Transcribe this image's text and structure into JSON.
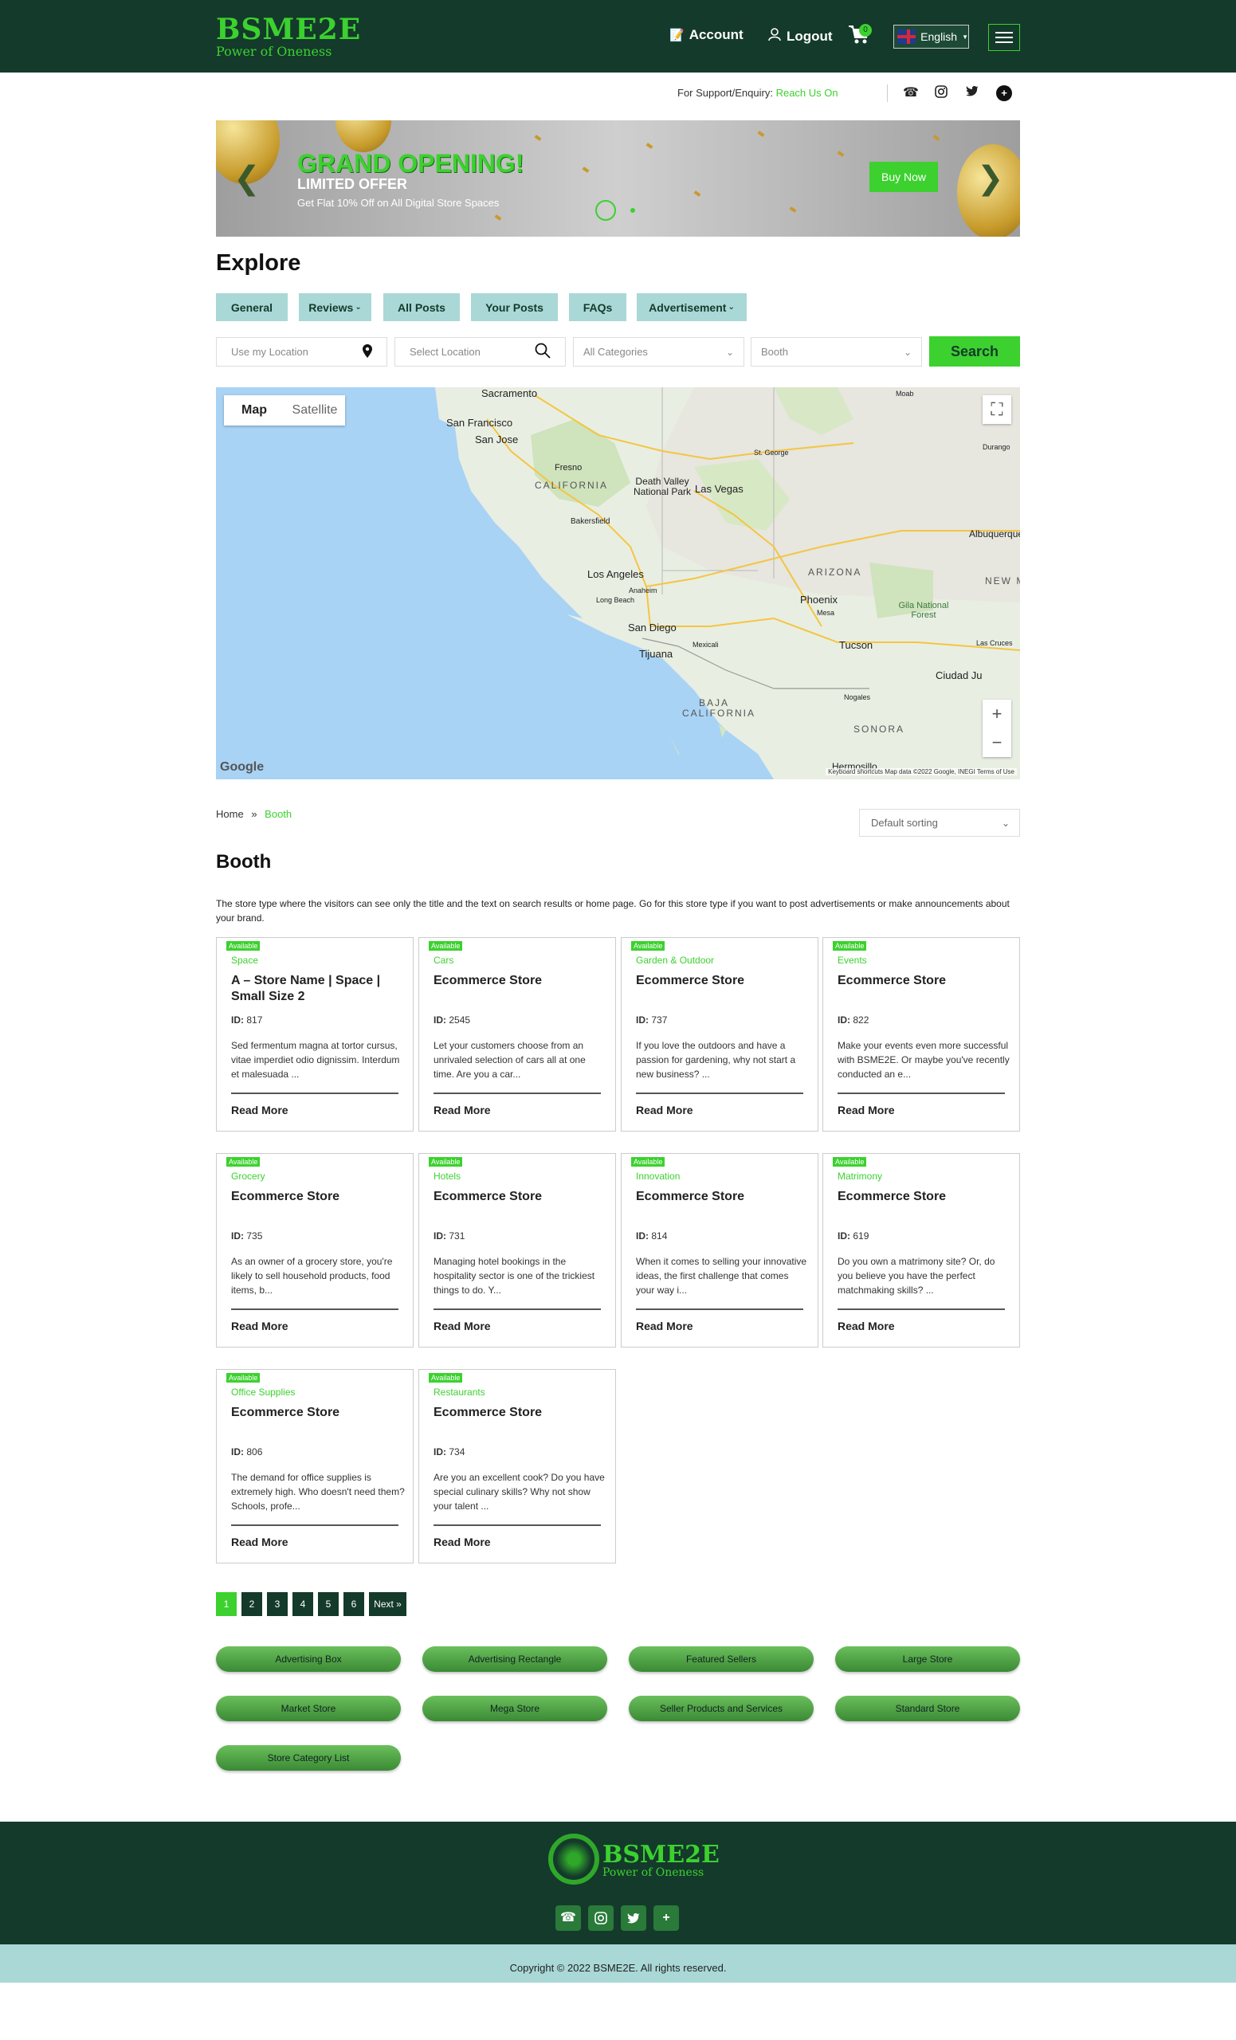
{
  "header": {
    "logo_main": "BSME2E",
    "logo_sub": "Power of Oneness",
    "account": "Account",
    "logout": "Logout",
    "cart_count": "0",
    "language": "English"
  },
  "support": {
    "label": "For Support/Enquiry:",
    "link": "Reach Us On"
  },
  "banner": {
    "title": "GRAND OPENING!",
    "subtitle": "LIMITED OFFER",
    "text": "Get Flat 10% Off on All Digital Store Spaces",
    "button": "Buy Now"
  },
  "explore": {
    "title": "Explore",
    "tabs": [
      "General",
      "Reviews",
      "All Posts",
      "Your Posts",
      "FAQs",
      "Advertisement"
    ]
  },
  "search": {
    "location_placeholder": "Use my Location",
    "select_location": "Select Location",
    "categories": "All Categories",
    "type": "Booth",
    "button": "Search"
  },
  "map": {
    "map_btn": "Map",
    "satellite_btn": "Satellite",
    "cities": [
      "Sacramento",
      "San Francisco",
      "San Jose",
      "Fresno",
      "CALIFORNIA",
      "Death Valley National Park",
      "Las Vegas",
      "Bakersfield",
      "Los Angeles",
      "Anaheim",
      "Long Beach",
      "San Diego",
      "Tijuana",
      "Mexicali",
      "Phoenix",
      "Mesa",
      "Tucson",
      "ARIZONA",
      "Albuquerque",
      "Gila National Forest",
      "Ciudad Ju",
      "Nogales",
      "SONORA",
      "BAJA CALIFORNIA",
      "Hermosillo",
      "St. George",
      "Moab",
      "Durango",
      "Las Cruces",
      "NEW M"
    ],
    "footer": "Keyboard shortcuts Map data ©2022 Google, INEGI Terms of Use"
  },
  "breadcrumb": {
    "home": "Home",
    "sep": "»",
    "current": "Booth"
  },
  "sorting": "Default sorting",
  "booth": {
    "title": "Booth",
    "description": "The store type where the visitors can see only the title and the text on search results or home page. Go for this store type if you want to post advertisements or make announcements about your brand."
  },
  "cards": [
    {
      "badge": "Available",
      "category": "Space",
      "title": "A – Store Name | Space | Small Size 2",
      "id_label": "ID:",
      "id": "817",
      "desc": "Sed fermentum magna at tortor cursus, vitae imperdiet odio dignissim. Interdum et malesuada ...",
      "read": "Read More"
    },
    {
      "badge": "Available",
      "category": "Cars",
      "title": "Ecommerce Store",
      "id_label": "ID:",
      "id": "2545",
      "desc": "Let your customers choose from an unrivaled selection of cars all at one time. Are you a car...",
      "read": "Read More"
    },
    {
      "badge": "Available",
      "category": "Garden & Outdoor",
      "title": "Ecommerce Store",
      "id_label": "ID:",
      "id": "737",
      "desc": "If you love the outdoors and have a passion for gardening, why not start a new business? ...",
      "read": "Read More"
    },
    {
      "badge": "Available",
      "category": "Events",
      "title": "Ecommerce Store",
      "id_label": "ID:",
      "id": "822",
      "desc": "Make your events even more successful with BSME2E. Or maybe you've recently conducted an e...",
      "read": "Read More"
    },
    {
      "badge": "Available",
      "category": "Grocery",
      "title": "Ecommerce Store",
      "id_label": "ID:",
      "id": "735",
      "desc": "As an owner of a grocery store, you're likely to sell household products, food items, b...",
      "read": "Read More"
    },
    {
      "badge": "Available",
      "category": "Hotels",
      "title": "Ecommerce Store",
      "id_label": "ID:",
      "id": "731",
      "desc": "Managing hotel bookings in the hospitality sector is one of the trickiest things to do. Y...",
      "read": "Read More"
    },
    {
      "badge": "Available",
      "category": "Innovation",
      "title": "Ecommerce Store",
      "id_label": "ID:",
      "id": "814",
      "desc": "When it comes to selling your innovative ideas, the first challenge that comes your way i...",
      "read": "Read More"
    },
    {
      "badge": "Available",
      "category": "Matrimony",
      "title": "Ecommerce Store",
      "id_label": "ID:",
      "id": "619",
      "desc": "Do you own a matrimony site? Or, do you believe you have the perfect matchmaking skills? ...",
      "read": "Read More"
    },
    {
      "badge": "Available",
      "category": "Office Supplies",
      "title": "Ecommerce Store",
      "id_label": "ID:",
      "id": "806",
      "desc": "The demand for office supplies is extremely high. Who doesn't need them? Schools, profe...",
      "read": "Read More"
    },
    {
      "badge": "Available",
      "category": "Restaurants",
      "title": "Ecommerce Store",
      "id_label": "ID:",
      "id": "734",
      "desc": "Are you an excellent cook? Do you have special culinary skills? Why not show your talent ...",
      "read": "Read More"
    }
  ],
  "pagination": [
    "1",
    "2",
    "3",
    "4",
    "5",
    "6",
    "Next »"
  ],
  "store_links": [
    "Advertising Box",
    "Advertising Rectangle",
    "Featured Sellers",
    "Large Store",
    "Market Store",
    "Mega Store",
    "Seller Products and Services",
    "Standard Store",
    "Store Category List"
  ],
  "footer": {
    "logo_main": "BSME2E",
    "logo_sub": "Power of Oneness",
    "copyright": "Copyright © 2022 BSME2E. All rights reserved."
  },
  "colors": {
    "brand_green": "#3cd12f",
    "dark_green": "#143a2b",
    "teal": "#a9d8d6"
  }
}
